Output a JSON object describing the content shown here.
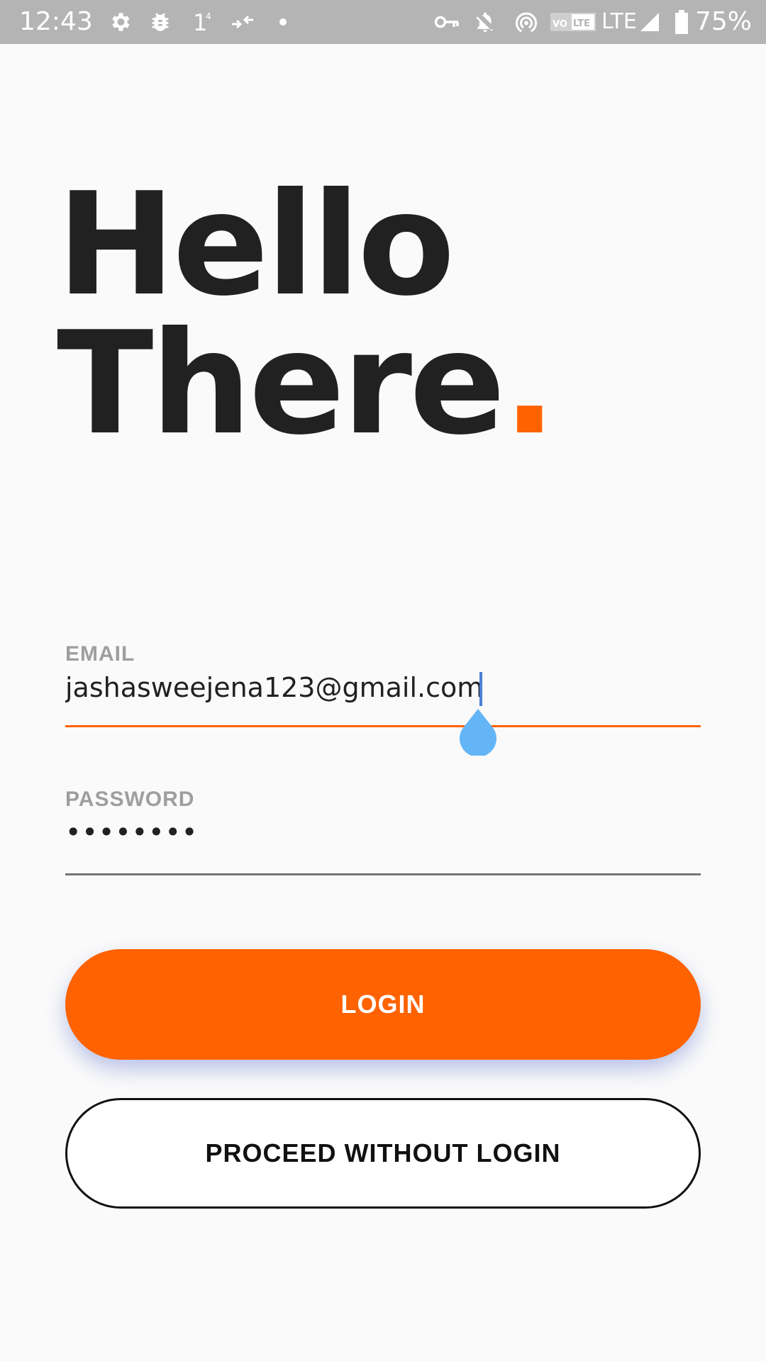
{
  "status_bar": {
    "time": "12:43",
    "network": "LTE",
    "battery": "75%",
    "icons": [
      "settings-icon",
      "bug-icon",
      "signal-one-icon",
      "data-arrows-icon",
      "notification-dot-icon",
      "key-icon",
      "mute-icon",
      "hotspot-icon",
      "volte-icon",
      "cell-signal-icon",
      "battery-icon"
    ]
  },
  "headline": {
    "line1": "Hello",
    "line2": "There",
    "dot": "."
  },
  "form": {
    "email_label": "EMAIL",
    "email_value": "jashasweejena123@gmail.com",
    "password_label": "PASSWORD",
    "password_value": "••••••••"
  },
  "buttons": {
    "login": "LOGIN",
    "skip": "PROCEED WITHOUT LOGIN"
  },
  "colors": {
    "accent": "#ff6200",
    "text": "#212121",
    "label": "#9e9e9e",
    "status_bar": "#b4b4b4",
    "cursor_handle": "#64b5f6"
  }
}
